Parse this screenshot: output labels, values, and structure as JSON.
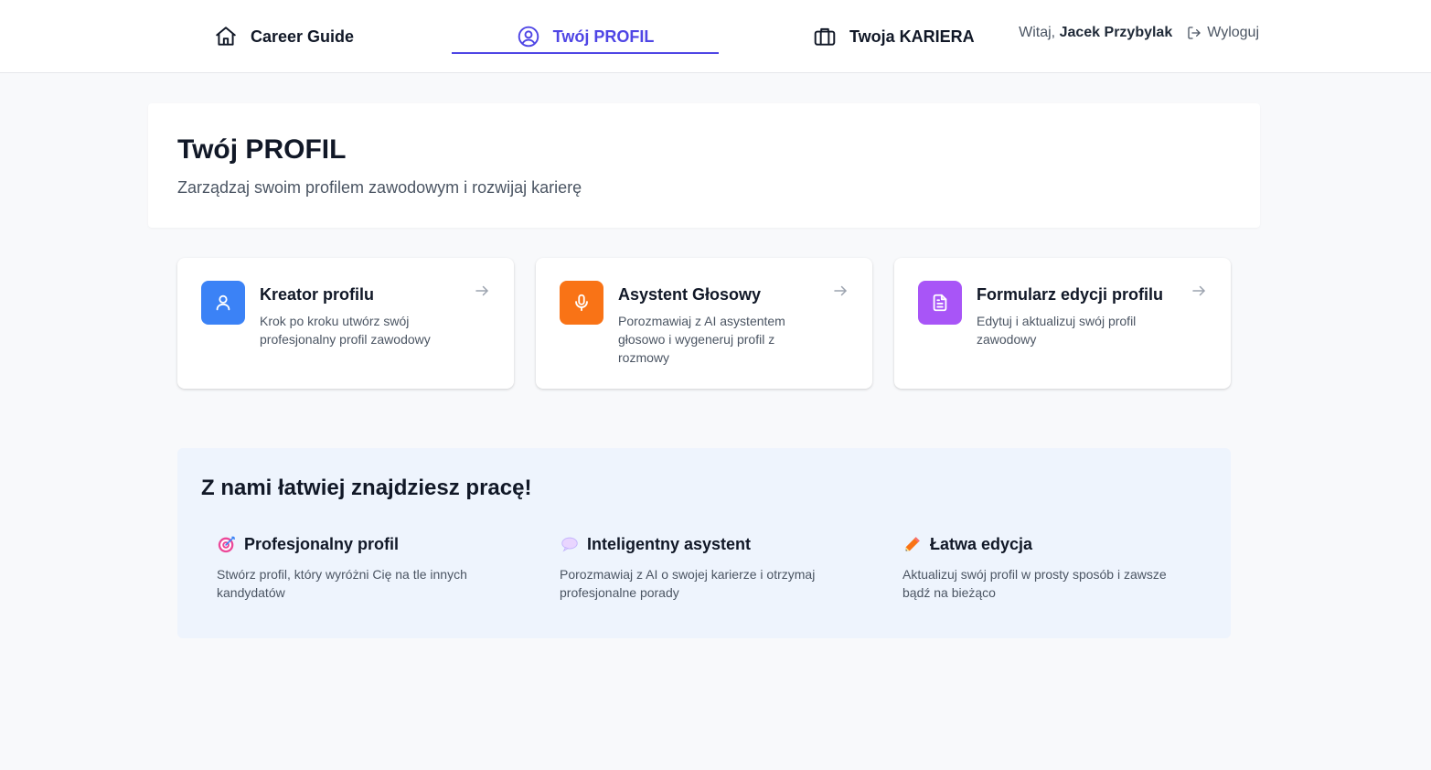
{
  "nav": {
    "home_label": "Career Guide",
    "profile_label": "Twój PROFIL",
    "career_label": "Twoja KARIERA"
  },
  "user": {
    "greeting": "Witaj,",
    "name": "Jacek Przybylak",
    "logout_label": "Wyloguj"
  },
  "header": {
    "title": "Twój PROFIL",
    "subtitle": "Zarządzaj swoim profilem zawodowym i rozwijaj karierę"
  },
  "cards": [
    {
      "title": "Kreator profilu",
      "description": "Krok po kroku utwórz swój profesjonalny profil zawodowy",
      "icon": "user-icon",
      "color": "#3b82f6"
    },
    {
      "title": "Asystent Głosowy",
      "description": "Porozmawiaj z AI asystentem głosowo i wygeneruj profil z rozmowy",
      "icon": "microphone-icon",
      "color": "#f97316"
    },
    {
      "title": "Formularz edycji profilu",
      "description": "Edytuj i aktualizuj swój profil zawodowy",
      "icon": "document-icon",
      "color": "#a855f7"
    }
  ],
  "info": {
    "title": "Z nami łatwiej znajdziesz pracę!",
    "features": [
      {
        "icon": "target-icon",
        "title": "Profesjonalny profil",
        "description": "Stwórz profil, który wyróżni Cię na tle innych kandydatów"
      },
      {
        "icon": "speech-bubble-icon",
        "title": "Inteligentny asystent",
        "description": "Porozmawiaj z AI o swojej karierze i otrzymaj profesjonalne porady"
      },
      {
        "icon": "pencil-icon",
        "title": "Łatwa edycja",
        "description": "Aktualizuj swój profil w prosty sposób i zawsze bądź na bieżąco"
      }
    ]
  },
  "colors": {
    "accent": "#4f46e5",
    "background": "#f8f9fb",
    "info_background": "#eef4fd"
  }
}
